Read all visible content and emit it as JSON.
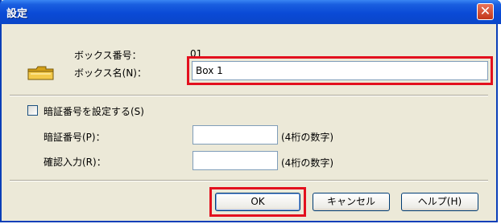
{
  "window": {
    "title": "設定",
    "close_icon": "close-icon",
    "close_glyph": "✕"
  },
  "box": {
    "number_label": "ボックス番号：",
    "number_value": "01",
    "name_label": "ボックス名(N)：",
    "name_value": "Box 1",
    "icon": "folder-icon"
  },
  "password": {
    "checkbox_label": "暗証番号を設定する(S)",
    "checked": false,
    "pin_label": "暗証番号(P)：",
    "pin_hint": "(4桁の数字)",
    "confirm_label": "確認入力(R)：",
    "confirm_hint": "(4桁の数字)"
  },
  "buttons": {
    "ok": "OK",
    "cancel": "キャンセル",
    "help": "ヘルプ(H)"
  },
  "colors": {
    "highlight": "#e3101e",
    "titlebar": "#0a4ad6"
  }
}
